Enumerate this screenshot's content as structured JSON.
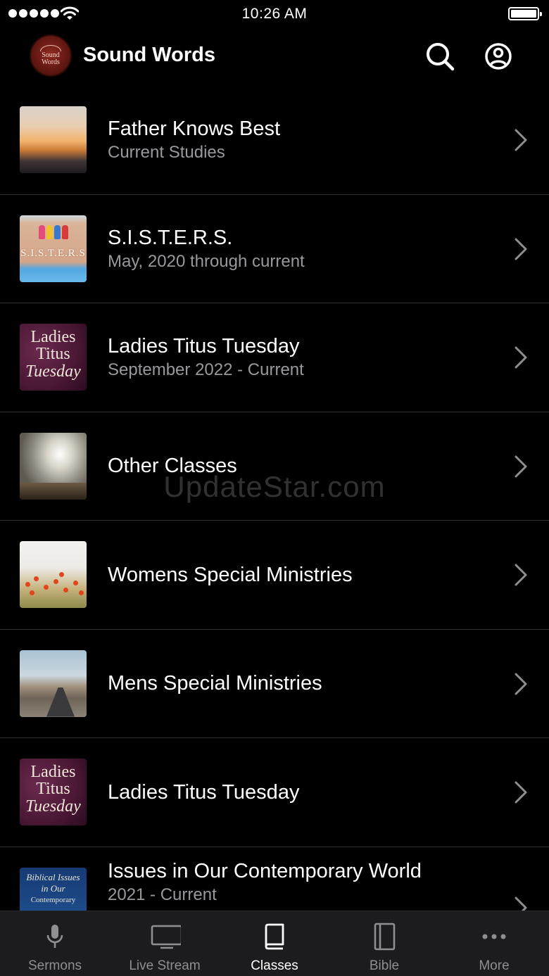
{
  "status_bar": {
    "time": "10:26 AM"
  },
  "header": {
    "title": "Sound Words",
    "logo_text": [
      "Sound",
      "Words"
    ]
  },
  "classes": [
    {
      "title": "Father Knows Best",
      "subtitle": "Current Studies",
      "thumbnail": "sunset-over-clouds"
    },
    {
      "title": "S.I.S.T.E.R.S.",
      "subtitle": "May, 2020 through current",
      "thumbnail": "sisters-logo",
      "thumb_text": "S.I.S.T.E.R.S"
    },
    {
      "title": "Ladies Titus Tuesday",
      "subtitle": "September 2022 - Current",
      "thumbnail": "ladies-titus-tuesday",
      "thumb_text": [
        "Ladies",
        "Titus",
        "Tuesday"
      ]
    },
    {
      "title": "Other Classes",
      "subtitle": "",
      "thumbnail": "sunlit-clouds"
    },
    {
      "title": "Womens Special Ministries",
      "subtitle": "",
      "thumbnail": "poppy-field"
    },
    {
      "title": "Mens Special Ministries",
      "subtitle": "",
      "thumbnail": "desert-road"
    },
    {
      "title": "Ladies Titus Tuesday",
      "subtitle": "",
      "thumbnail": "ladies-titus-tuesday",
      "thumb_text": [
        "Ladies",
        "Titus",
        "Tuesday"
      ]
    },
    {
      "title": "Issues in Our Contemporary World",
      "subtitle": "2021 - Current",
      "thumbnail": "biblical-issues",
      "thumb_text": [
        "Biblical Issues",
        "in Our",
        "Contemporary"
      ]
    }
  ],
  "watermark": "UpdateStar.com",
  "tabs": [
    {
      "label": "Sermons",
      "icon": "microphone-icon",
      "active": false
    },
    {
      "label": "Live Stream",
      "icon": "monitor-icon",
      "active": false
    },
    {
      "label": "Classes",
      "icon": "book-icon",
      "active": true
    },
    {
      "label": "Bible",
      "icon": "bible-icon",
      "active": false
    },
    {
      "label": "More",
      "icon": "ellipsis-icon",
      "active": false
    }
  ],
  "colors": {
    "background": "#000000",
    "tab_bar": "#1c1c1e",
    "separator": "#2e2e30",
    "secondary_text": "#98989d",
    "inactive_tab": "#8e8e93",
    "logo": "#6b1c14"
  }
}
